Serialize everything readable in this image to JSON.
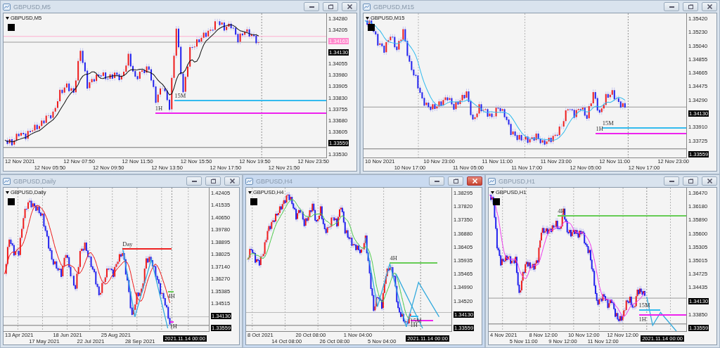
{
  "windows": [
    {
      "title": "GBPUSD,M5",
      "symbol": "GBPUSD,M5",
      "active": false,
      "price_labels": [
        {
          "kind": "label",
          "text": "1.34280"
        },
        {
          "kind": "label",
          "text": "1.34205"
        },
        {
          "kind": "tag",
          "text": "1.34163",
          "color": "#ff88cc"
        },
        {
          "kind": "tag",
          "text": "1.34130",
          "color": "#000000"
        },
        {
          "kind": "label",
          "text": "1.34055"
        },
        {
          "kind": "label",
          "text": "1.33980"
        },
        {
          "kind": "label",
          "text": "1.33905"
        },
        {
          "kind": "label",
          "text": "1.33830"
        },
        {
          "kind": "label",
          "text": "1.33755"
        },
        {
          "kind": "label",
          "text": "1.33680"
        },
        {
          "kind": "label",
          "text": "1.33605"
        },
        {
          "kind": "tag",
          "text": "1.33559",
          "color": "#000000"
        },
        {
          "kind": "label",
          "text": "1.33530"
        }
      ],
      "time_labels": [
        {
          "kind": "label",
          "text": "12 Nov 2021"
        },
        {
          "kind": "label",
          "text": "12 Nov 05:50"
        },
        {
          "kind": "label",
          "text": "12 Nov 07:50"
        },
        {
          "kind": "label",
          "text": "12 Nov 09:50"
        },
        {
          "kind": "label",
          "text": "12 Nov 11:50"
        },
        {
          "kind": "label",
          "text": "12 Nov 13:50"
        },
        {
          "kind": "label",
          "text": "12 Nov 15:50"
        },
        {
          "kind": "label",
          "text": "12 Nov 17:50"
        },
        {
          "kind": "label",
          "text": "12 Nov 19:50"
        },
        {
          "kind": "label",
          "text": "12 Nov 21:50"
        },
        {
          "kind": "label",
          "text": "12 Nov 23:50"
        }
      ],
      "levels": [
        {
          "label": "15M",
          "color": "#33bbee"
        },
        {
          "label": "1H",
          "color": "#ee22ee"
        }
      ]
    },
    {
      "title": "GBPUSD,M15",
      "symbol": "GBPUSD,M15",
      "active": false,
      "price_labels": [
        {
          "kind": "label",
          "text": "1.35420"
        },
        {
          "kind": "label",
          "text": "1.35230"
        },
        {
          "kind": "label",
          "text": "1.35040"
        },
        {
          "kind": "label",
          "text": "1.34855"
        },
        {
          "kind": "label",
          "text": "1.34665"
        },
        {
          "kind": "label",
          "text": "1.34475"
        },
        {
          "kind": "label",
          "text": "1.34290"
        },
        {
          "kind": "tag",
          "text": "1.34130",
          "color": "#000000"
        },
        {
          "kind": "label",
          "text": "1.33910"
        },
        {
          "kind": "label",
          "text": "1.33725"
        },
        {
          "kind": "tag",
          "text": "1.33559",
          "color": "#000000"
        }
      ],
      "time_labels": [
        {
          "kind": "label",
          "text": "10 Nov 2021"
        },
        {
          "kind": "label",
          "text": "10 Nov 17:00"
        },
        {
          "kind": "label",
          "text": "10 Nov 23:00"
        },
        {
          "kind": "label",
          "text": "11 Nov 05:00"
        },
        {
          "kind": "label",
          "text": "11 Nov 11:00"
        },
        {
          "kind": "label",
          "text": "11 Nov 17:00"
        },
        {
          "kind": "label",
          "text": "11 Nov 23:00"
        },
        {
          "kind": "label",
          "text": "12 Nov 05:00"
        },
        {
          "kind": "label",
          "text": "12 Nov 11:00"
        },
        {
          "kind": "label",
          "text": "12 Nov 17:00"
        },
        {
          "kind": "label",
          "text": "12 Nov 23:00"
        }
      ],
      "levels": [
        {
          "label": "15M",
          "color": "#33bbee"
        },
        {
          "label": "1H",
          "color": "#ee22ee"
        }
      ]
    },
    {
      "title": "GBPUSD,Daily",
      "symbol": "GBPUSD,Daily",
      "active": false,
      "price_labels": [
        {
          "kind": "label",
          "text": "1.42405"
        },
        {
          "kind": "label",
          "text": "1.41535"
        },
        {
          "kind": "label",
          "text": "1.40650"
        },
        {
          "kind": "label",
          "text": "1.39780"
        },
        {
          "kind": "label",
          "text": "1.38895"
        },
        {
          "kind": "label",
          "text": "1.38025"
        },
        {
          "kind": "label",
          "text": "1.37140"
        },
        {
          "kind": "label",
          "text": "1.36270"
        },
        {
          "kind": "label",
          "text": "1.35385"
        },
        {
          "kind": "label",
          "text": "1.34515"
        },
        {
          "kind": "tag",
          "text": "1.34130",
          "color": "#000000"
        },
        {
          "kind": "tag",
          "text": "1.33559",
          "color": "#000000"
        }
      ],
      "time_labels": [
        {
          "kind": "label",
          "text": "13 Apr 2021"
        },
        {
          "kind": "label",
          "text": "17 May 2021"
        },
        {
          "kind": "label",
          "text": "18 Jun 2021"
        },
        {
          "kind": "label",
          "text": "22 Jul 2021"
        },
        {
          "kind": "label",
          "text": "25 Aug 2021"
        },
        {
          "kind": "label",
          "text": "28 Sep 2021"
        },
        {
          "kind": "tag",
          "text": "2021.11.14 00:00"
        }
      ],
      "levels": [
        {
          "label": "Day",
          "color": "#ee2222"
        },
        {
          "label": "4H",
          "color": "#66cc55"
        },
        {
          "label": "1H",
          "color": "#ee22ee"
        }
      ]
    },
    {
      "title": "GBPUSD,H4",
      "symbol": "GBPUSD,H4",
      "active": true,
      "price_labels": [
        {
          "kind": "label",
          "text": "1.38295"
        },
        {
          "kind": "label",
          "text": "1.37820"
        },
        {
          "kind": "label",
          "text": "1.37350"
        },
        {
          "kind": "label",
          "text": "1.36880"
        },
        {
          "kind": "label",
          "text": "1.36405"
        },
        {
          "kind": "label",
          "text": "1.35935"
        },
        {
          "kind": "label",
          "text": "1.35465"
        },
        {
          "kind": "label",
          "text": "1.34990"
        },
        {
          "kind": "label",
          "text": "1.34520"
        },
        {
          "kind": "tag",
          "text": "1.34130",
          "color": "#000000"
        },
        {
          "kind": "tag",
          "text": "1.33559",
          "color": "#000000"
        }
      ],
      "time_labels": [
        {
          "kind": "label",
          "text": "8 Oct 2021"
        },
        {
          "kind": "label",
          "text": "14 Oct 08:00"
        },
        {
          "kind": "label",
          "text": "20 Oct 08:00"
        },
        {
          "kind": "label",
          "text": "26 Oct 08:00"
        },
        {
          "kind": "label",
          "text": "1 Nov 04:00"
        },
        {
          "kind": "label",
          "text": "5 Nov 04:00"
        },
        {
          "kind": "tag",
          "text": "2021.11.14 00:00"
        }
      ],
      "levels": [
        {
          "label": "4H",
          "color": "#66cc55"
        },
        {
          "label": "15M",
          "color": "#33bbee"
        },
        {
          "label": "1H",
          "color": "#ee22ee"
        }
      ]
    },
    {
      "title": "GBPUSD,H1",
      "symbol": "GBPUSD,H1",
      "active": false,
      "price_labels": [
        {
          "kind": "label",
          "text": "1.36470"
        },
        {
          "kind": "label",
          "text": "1.36180"
        },
        {
          "kind": "label",
          "text": "1.35890"
        },
        {
          "kind": "label",
          "text": "1.35600"
        },
        {
          "kind": "label",
          "text": "1.35305"
        },
        {
          "kind": "label",
          "text": "1.35015"
        },
        {
          "kind": "label",
          "text": "1.34725"
        },
        {
          "kind": "label",
          "text": "1.34435"
        },
        {
          "kind": "tag",
          "text": "1.34130",
          "color": "#000000"
        },
        {
          "kind": "label",
          "text": "1.33850"
        },
        {
          "kind": "tag",
          "text": "1.33559",
          "color": "#000000"
        }
      ],
      "time_labels": [
        {
          "kind": "label",
          "text": "4 Nov 2021"
        },
        {
          "kind": "label",
          "text": "5 Nov 11:00"
        },
        {
          "kind": "label",
          "text": "8 Nov 12:00"
        },
        {
          "kind": "label",
          "text": "9 Nov 12:00"
        },
        {
          "kind": "label",
          "text": "10 Nov 12:00"
        },
        {
          "kind": "label",
          "text": "11 Nov 12:00"
        },
        {
          "kind": "label",
          "text": "12 Nov 12:00"
        },
        {
          "kind": "tag",
          "text": "2021.11.14 00:00"
        }
      ],
      "levels": [
        {
          "label": "4H",
          "color": "#66cc55"
        },
        {
          "label": "15M",
          "color": "#33bbee"
        },
        {
          "label": "1H",
          "color": "#ee22ee"
        }
      ]
    }
  ]
}
